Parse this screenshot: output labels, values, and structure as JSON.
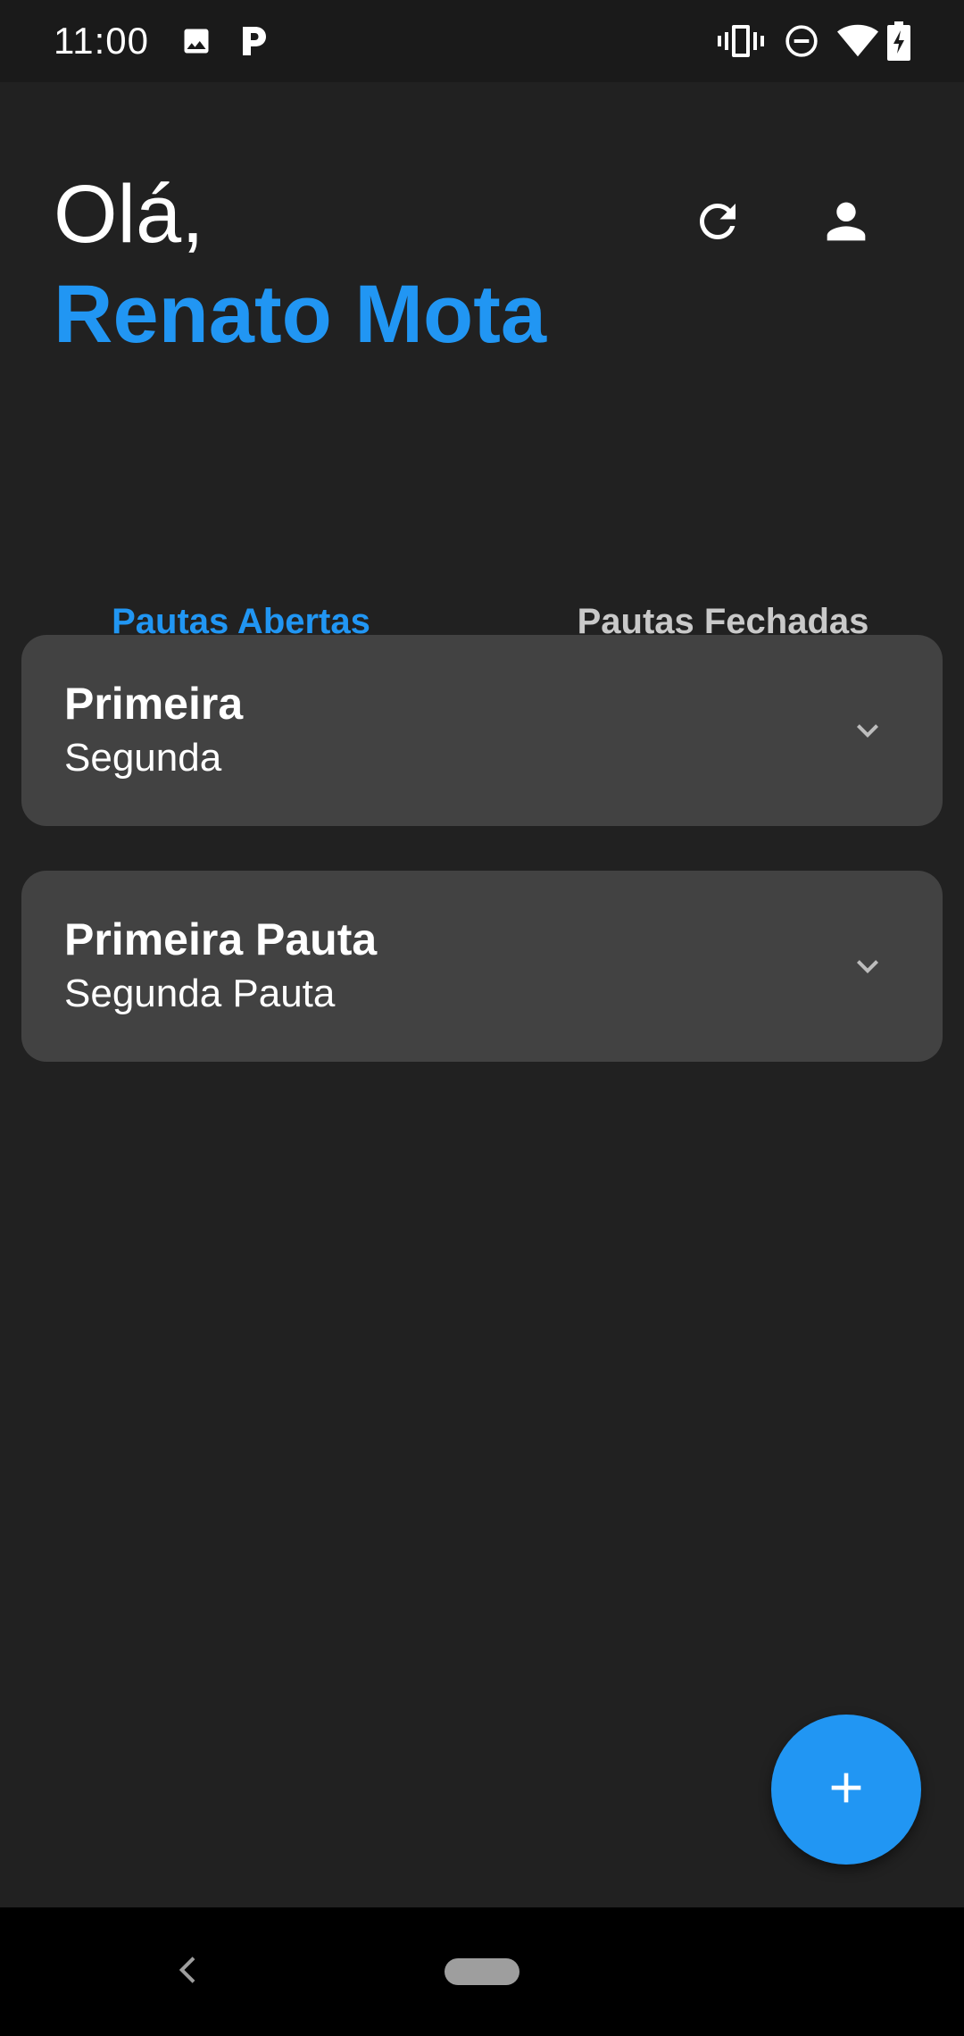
{
  "status_bar": {
    "time": "11:00",
    "icons_left": [
      "image-icon",
      "p-notification-icon"
    ],
    "icons_right": [
      "vibrate-icon",
      "do-not-disturb-icon",
      "wifi-icon",
      "battery-charging-icon"
    ]
  },
  "header": {
    "greeting": "Olá,",
    "username": "Renato Mota",
    "actions": [
      "refresh-icon",
      "account-icon"
    ]
  },
  "tabs": [
    {
      "label": "Pautas Abertas",
      "active": true
    },
    {
      "label": "Pautas Fechadas",
      "active": false
    }
  ],
  "cards": [
    {
      "title": "Primeira",
      "subtitle": "Segunda"
    },
    {
      "title": "Primeira Pauta",
      "subtitle": "Segunda Pauta"
    }
  ],
  "fab": {
    "icon": "add-icon"
  },
  "colors": {
    "accent": "#2196f3",
    "background": "#212121",
    "card": "#424242",
    "text_primary": "#ffffff",
    "text_secondary": "#c9c9c9"
  }
}
